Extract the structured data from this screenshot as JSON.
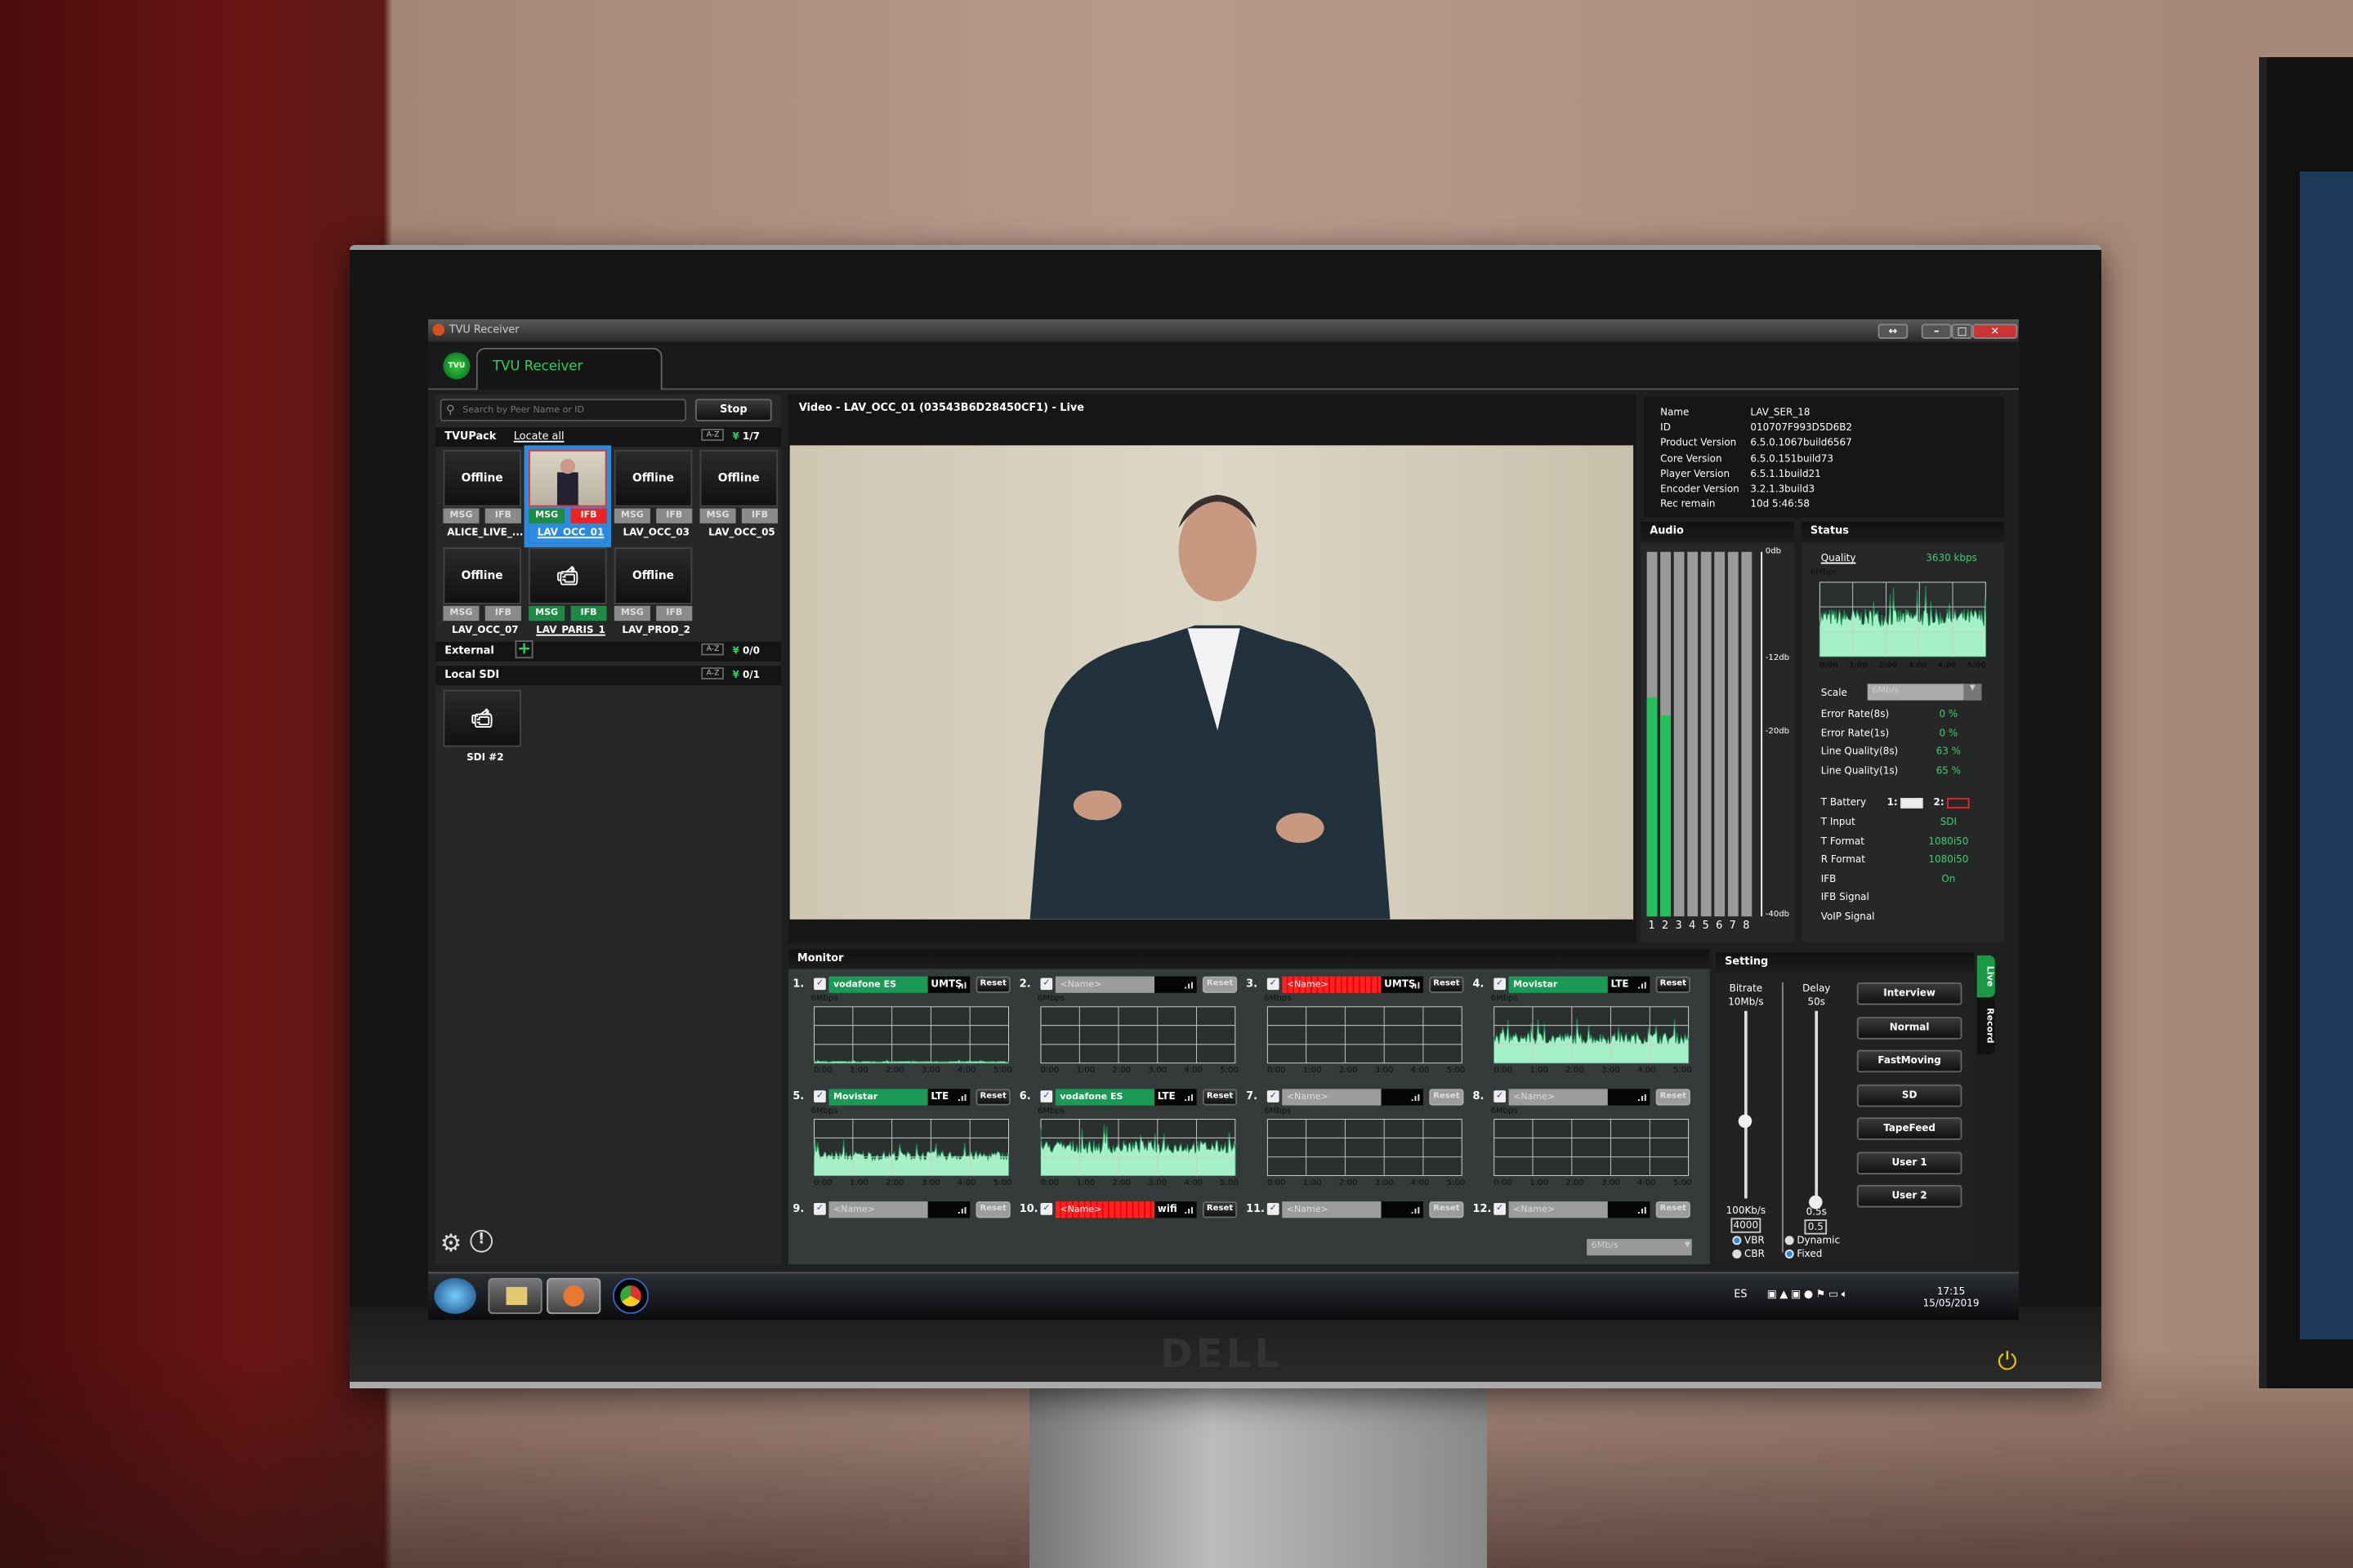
{
  "window": {
    "title": "TVU Receiver",
    "tab": "TVU Receiver",
    "logo": "TVU"
  },
  "left": {
    "search_placeholder": "Search by Peer Name or ID",
    "stop": "Stop",
    "tvupack": {
      "label": "TVUPack",
      "locate": "Locate all",
      "sort": "A-Z",
      "count": "1/7"
    },
    "tiles": [
      {
        "name": "ALICE_LIVE_...",
        "state": "Offline",
        "msg": "MSG",
        "ifb": "IFB",
        "msg_color": "grey",
        "ifb_color": "grey"
      },
      {
        "name": "LAV_OCC_01",
        "state": "live",
        "msg": "MSG",
        "ifb": "IFB",
        "msg_color": "green",
        "ifb_color": "red",
        "selected": true
      },
      {
        "name": "LAV_OCC_03",
        "state": "Offline",
        "msg": "MSG",
        "ifb": "IFB",
        "msg_color": "grey",
        "ifb_color": "grey"
      },
      {
        "name": "LAV_OCC_05",
        "state": "Offline",
        "msg": "MSG",
        "ifb": "IFB",
        "msg_color": "grey",
        "ifb_color": "grey"
      },
      {
        "name": "LAV_OCC_07",
        "state": "Offline",
        "msg": "MSG",
        "ifb": "IFB",
        "msg_color": "grey",
        "ifb_color": "grey"
      },
      {
        "name": "LAV_PARIS_1",
        "state": "no-video",
        "msg": "MSG",
        "ifb": "IFB",
        "msg_color": "green",
        "ifb_color": "green"
      },
      {
        "name": "LAV_PROD_2",
        "state": "Offline",
        "msg": "MSG",
        "ifb": "IFB",
        "msg_color": "grey",
        "ifb_color": "grey"
      }
    ],
    "external": {
      "label": "External",
      "sort": "A-Z",
      "count": "0/0"
    },
    "local_sdi": {
      "label": "Local SDI",
      "sort": "A-Z",
      "count": "0/1",
      "tile": "SDI #2"
    }
  },
  "video": {
    "title": "Video - LAV_OCC_01 (03543B6D28450CF1) - Live"
  },
  "info": [
    {
      "k": "Name",
      "v": "LAV_SER_18"
    },
    {
      "k": "ID",
      "v": "010707F993D5D6B2"
    },
    {
      "k": "Product Version",
      "v": "6.5.0.1067build6567"
    },
    {
      "k": "Core Version",
      "v": "6.5.0.151build73"
    },
    {
      "k": "Player Version",
      "v": "6.5.1.1build21"
    },
    {
      "k": "Encoder Version",
      "v": "3.2.1.3build3"
    },
    {
      "k": "Rec remain",
      "v": "10d 5:46:58"
    }
  ],
  "audio": {
    "title": "Audio",
    "channels": [
      "1",
      "2",
      "3",
      "4",
      "5",
      "6",
      "7",
      "8"
    ],
    "levels_db": [
      -16,
      -18,
      null,
      null,
      null,
      null,
      null,
      null
    ],
    "scale": [
      "0db",
      "-12db",
      "-20db",
      "-40db"
    ]
  },
  "status": {
    "title": "Status",
    "quality_label": "Quality",
    "quality_value": "3630 kbps",
    "chart_max": "6Mbps",
    "times": [
      "0:00",
      "1:00",
      "2:00",
      "3:00",
      "4:00",
      "5:00"
    ],
    "scale_label": "Scale",
    "scale_value": "6Mb/s",
    "rows": [
      {
        "k": "Error Rate(8s)",
        "v": "0 %"
      },
      {
        "k": "Error Rate(1s)",
        "v": "0 %"
      },
      {
        "k": "Line Quality(8s)",
        "v": "63 %"
      },
      {
        "k": "Line Quality(1s)",
        "v": "65 %"
      }
    ],
    "battery_label": "T Battery",
    "battery1": "1:",
    "battery2": "2:",
    "rows2": [
      {
        "k": "T Input",
        "v": "SDI"
      },
      {
        "k": "T Format",
        "v": "1080i50"
      },
      {
        "k": "R Format",
        "v": "1080i50"
      },
      {
        "k": "IFB",
        "v": "On"
      },
      {
        "k": "IFB Signal",
        "v": ""
      },
      {
        "k": "VoIP Signal",
        "v": ""
      }
    ]
  },
  "monitor": {
    "title": "Monitor",
    "chart_max": "6Mbps",
    "reset": "Reset",
    "times": [
      "0:00",
      "1:00",
      "2:00",
      "3:00",
      "4:00",
      "5:00"
    ],
    "scale_value": "6Mb/s",
    "cells": [
      {
        "n": "1.",
        "name": "vodafone ES",
        "type": "UMTS",
        "state": "green",
        "mbps": 0.2
      },
      {
        "n": "2.",
        "name": "<Name>",
        "type": "",
        "state": "grey",
        "mbps": 0
      },
      {
        "n": "3.",
        "name": "<Name>",
        "type": "UMTS",
        "state": "red",
        "mbps": 0
      },
      {
        "n": "4.",
        "name": "Movistar",
        "type": "LTE",
        "state": "green",
        "mbps": 2.6
      },
      {
        "n": "5.",
        "name": "Movistar",
        "type": "LTE",
        "state": "green",
        "mbps": 2.1
      },
      {
        "n": "6.",
        "name": "vodafone ES",
        "type": "LTE",
        "state": "green",
        "mbps": 3.0
      },
      {
        "n": "7.",
        "name": "<Name>",
        "type": "",
        "state": "grey",
        "mbps": 0
      },
      {
        "n": "8.",
        "name": "<Name>",
        "type": "",
        "state": "grey",
        "mbps": 0
      },
      {
        "n": "9.",
        "name": "<Name>",
        "type": "",
        "state": "grey",
        "mbps": 0
      },
      {
        "n": "10.",
        "name": "<Name>",
        "type": "wifi",
        "state": "red",
        "mbps": 0
      },
      {
        "n": "11.",
        "name": "<Name>",
        "type": "",
        "state": "grey",
        "mbps": 0
      },
      {
        "n": "12.",
        "name": "<Name>",
        "type": "",
        "state": "grey",
        "mbps": 0
      }
    ]
  },
  "setting": {
    "title": "Setting",
    "bitrate_label": "Bitrate",
    "bitrate_max": "10Mb/s",
    "bitrate_min": "100Kb/s",
    "bitrate_value": "4000",
    "delay_label": "Delay",
    "delay_max": "50s",
    "delay_min": "0.5s",
    "delay_value": "0.5",
    "vbr": "VBR",
    "cbr": "CBR",
    "dynamic": "Dynamic",
    "fixed": "Fixed",
    "presets": [
      "Interview",
      "Normal",
      "FastMoving",
      "SD",
      "TapeFeed",
      "User 1",
      "User 2"
    ],
    "tabs": [
      "Live",
      "Record"
    ]
  },
  "taskbar": {
    "lang": "ES",
    "time": "17:15",
    "date": "15/05/2019"
  },
  "monitor_brand": "DELL"
}
